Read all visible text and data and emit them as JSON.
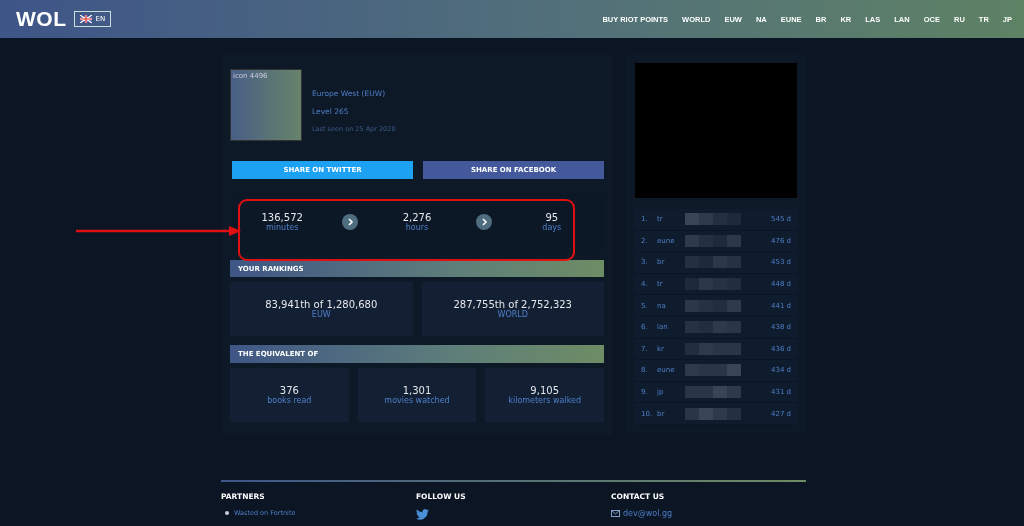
{
  "header": {
    "logo": "WOL",
    "language": "EN",
    "nav": [
      "BUY RIOT POINTS",
      "WORLD",
      "EUW",
      "NA",
      "EUNE",
      "BR",
      "KR",
      "LAS",
      "LAN",
      "OCE",
      "RU",
      "TR",
      "JP"
    ]
  },
  "profile": {
    "icon_alt": "icon 4496",
    "region": "Europe West (EUW)",
    "level": "Level 265",
    "last_seen": "Last seen on 25 Apr 2020"
  },
  "share": [
    {
      "label": "SHARE ON TWITTER",
      "kind": "twitter"
    },
    {
      "label": "SHARE ON FACEBOOK",
      "kind": "facebook"
    }
  ],
  "time_stats": [
    {
      "value": "136,572",
      "unit": "minutes"
    },
    {
      "value": "2,276",
      "unit": "hours"
    },
    {
      "value": "95",
      "unit": "days"
    }
  ],
  "rankings": {
    "title": "YOUR RANKINGS",
    "items": [
      {
        "value": "83,941th of 1,280,680",
        "label": "EUW"
      },
      {
        "value": "287,755th of 2,752,323",
        "label": "WORLD"
      }
    ]
  },
  "equivalent": {
    "title": "THE EQUIVALENT OF",
    "items": [
      {
        "value": "376",
        "label": "books read"
      },
      {
        "value": "1,301",
        "label": "movies watched"
      },
      {
        "value": "9,105",
        "label": "kilometers walked"
      }
    ]
  },
  "leaderboard": [
    {
      "rank": "1.",
      "region": "tr",
      "time": "545 d"
    },
    {
      "rank": "2.",
      "region": "eune",
      "time": "476 d"
    },
    {
      "rank": "3.",
      "region": "br",
      "time": "453 d"
    },
    {
      "rank": "4.",
      "region": "tr",
      "time": "448 d"
    },
    {
      "rank": "5.",
      "region": "na",
      "time": "441 d"
    },
    {
      "rank": "6.",
      "region": "lan",
      "time": "438 d"
    },
    {
      "rank": "7.",
      "region": "kr",
      "time": "436 d"
    },
    {
      "rank": "8.",
      "region": "eune",
      "time": "434 d"
    },
    {
      "rank": "9.",
      "region": "jp",
      "time": "431 d"
    },
    {
      "rank": "10.",
      "region": "br",
      "time": "427 d"
    }
  ],
  "footer": {
    "partners": {
      "title": "PARTNERS",
      "links": [
        "Wasted on Fortnite"
      ]
    },
    "follow": {
      "title": "FOLLOW US"
    },
    "contact": {
      "title": "CONTACT US",
      "email": "dev@wol.gg"
    }
  }
}
